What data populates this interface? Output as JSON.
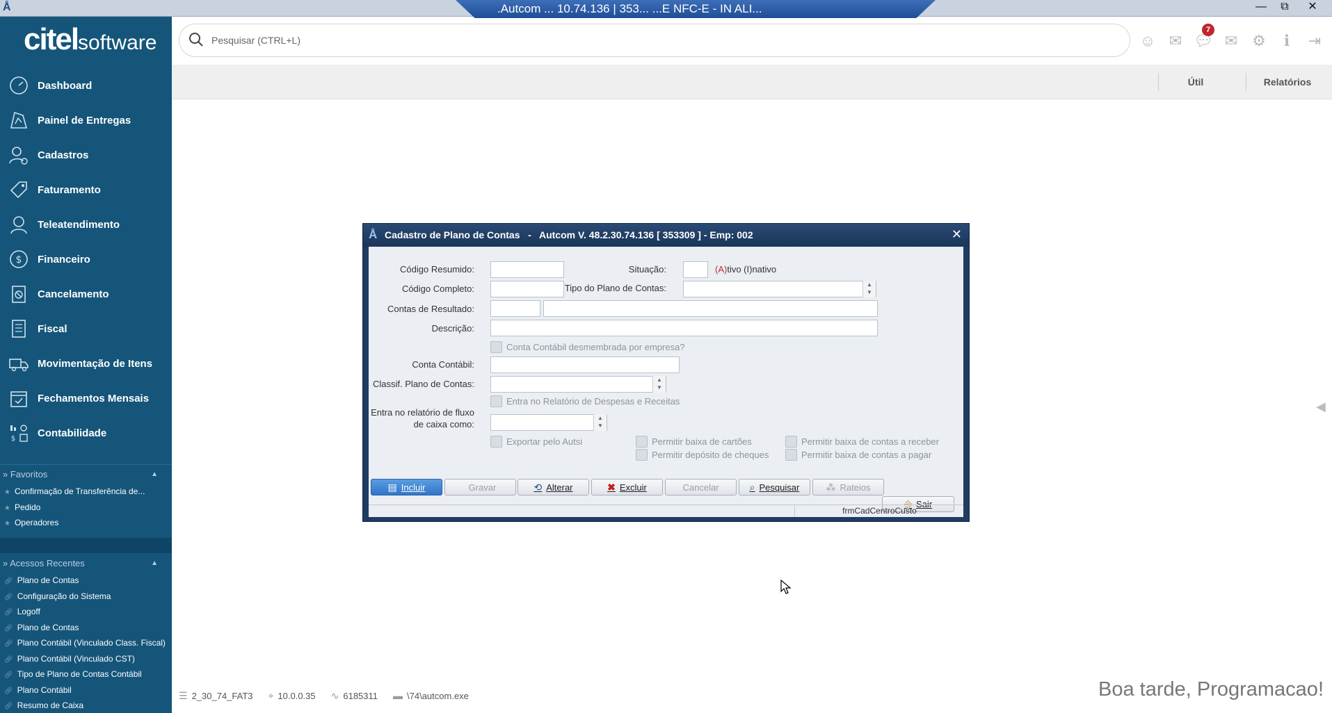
{
  "window": {
    "remote_title": ".Autcom  ...  10.74.136 | 353...  ...E NFC-E - IN ALI...",
    "minimize": "—",
    "restore": "⧉",
    "close": "✕"
  },
  "brand": {
    "logo_main": "citel",
    "logo_sub": "software"
  },
  "sidebar": {
    "items": [
      {
        "label": "Dashboard",
        "icon": "speedometer-icon"
      },
      {
        "label": "Painel de Entregas",
        "icon": "delivery-map-icon"
      },
      {
        "label": "Cadastros",
        "icon": "user-add-icon"
      },
      {
        "label": "Faturamento",
        "icon": "tag-icon"
      },
      {
        "label": "Teleatendimento",
        "icon": "headset-icon"
      },
      {
        "label": "Financeiro",
        "icon": "dollar-icon"
      },
      {
        "label": "Cancelamento",
        "icon": "cancel-document-icon"
      },
      {
        "label": "Fiscal",
        "icon": "document-icon"
      },
      {
        "label": "Movimentação de Itens",
        "icon": "truck-icon"
      },
      {
        "label": "Fechamentos Mensais",
        "icon": "calendar-check-icon"
      },
      {
        "label": "Contabilidade",
        "icon": "accounting-icon"
      }
    ],
    "favorites": {
      "title": "» Favoritos",
      "items": [
        "Confirmação de Transferência de...",
        "Pedido",
        "Operadores"
      ]
    },
    "recent": {
      "title": "» Acessos Recentes",
      "items": [
        "Plano de Contas",
        "Configuração do Sistema",
        "Logoff",
        "Plano de Contas",
        "Plano Contábil (Vinculado Class. Fiscal)",
        "Plano Contábil (Vinculado CST)",
        "Tipo de Plano de Contas Contábil",
        "Plano Contábil",
        "Resumo de Caixa"
      ]
    }
  },
  "search": {
    "placeholder": "Pesquisar (CTRL+L)"
  },
  "header": {
    "notifications_count": "7"
  },
  "strip": {
    "tab_util": "Útil",
    "tab_relatorios": "Relatórios"
  },
  "dialog": {
    "title": "Cadastro de Plano de Contas   -   Autcom V. 48.2.30.74.136 [ 353309 ] - Emp: 002",
    "close": "✕",
    "labels": {
      "codigo_resumido": "Código Resumido:",
      "situacao": "Situação:",
      "situacao_hint_a": "(A)",
      "situacao_hint_rest": "tivo (I)nativo",
      "codigo_completo": "Código Completo:",
      "tipo_plano": "Tipo do Plano de Contas:",
      "contas_resultado": "Contas de Resultado:",
      "descricao": "Descrição:",
      "conta_desmembrada": "Conta Contábil desmembrada por empresa?",
      "conta_contabil": "Conta Contábil:",
      "classif_plano": "Classif. Plano de Contas:",
      "entra_relatorio": "Entra no Relatório de Despesas e Receitas",
      "fluxo_line1": "Entra no relatório de fluxo",
      "fluxo_line2": "de caixa como:",
      "exportar_autsi": "Exportar pelo Autsi",
      "baixa_cartoes": "Permitir baixa de cartões",
      "deposito_cheques": "Permitir depósito de cheques",
      "baixa_receber": "Permitir baixa de contas a receber",
      "baixa_pagar": "Permitir baixa de contas a pagar"
    },
    "buttons": {
      "incluir": "Incluir",
      "gravar": "Gravar",
      "alterar": "Alterar",
      "excluir": "Excluir",
      "cancelar": "Cancelar",
      "pesquisar": "Pesquisar",
      "rateios": "Rateios",
      "sair": "Sair"
    },
    "status_form": "frmCadCentroCusto"
  },
  "statusbar": {
    "database": "2_30_74_FAT3",
    "ip": "10.0.0.35",
    "connection": "6185311",
    "path": "\\74\\autcom.exe"
  },
  "greeting": "Boa tarde, Programacao!"
}
